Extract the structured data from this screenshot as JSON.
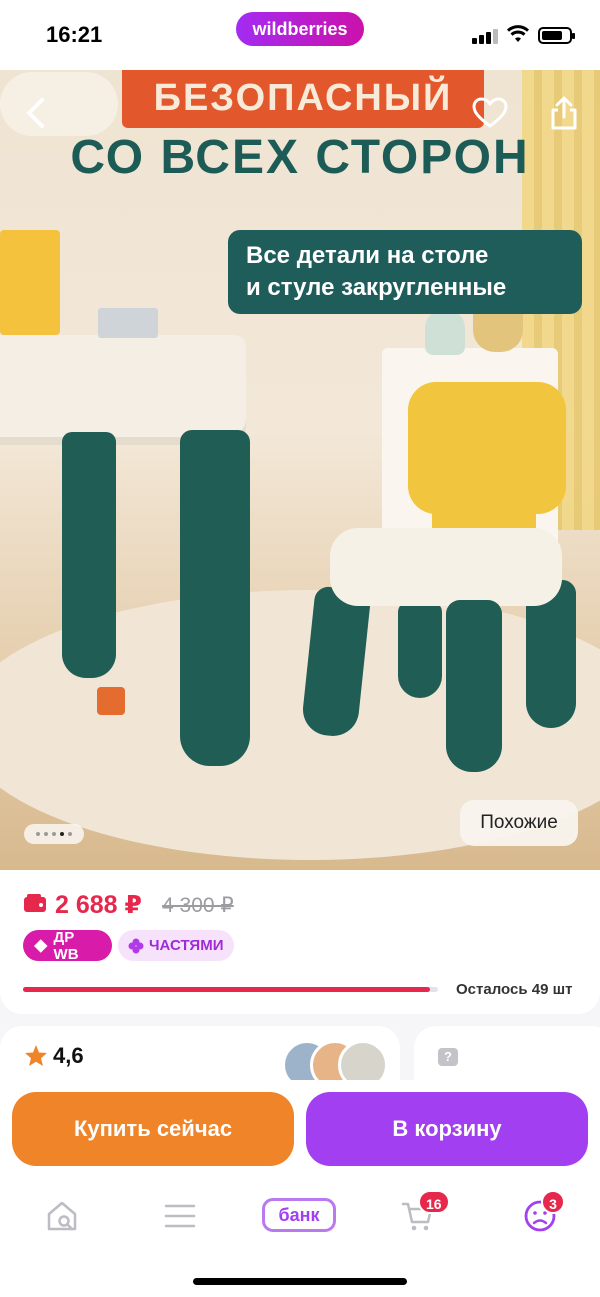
{
  "status_bar": {
    "time": "16:21",
    "brand": "wildberries"
  },
  "hero": {
    "promo_top": "БЕЗОПАСНЫЙ",
    "promo_title": "СО ВСЕХ СТОРОН",
    "promo_note_line1": "Все детали на столе",
    "promo_note_line2": "и стуле закругленные",
    "similar_label": "Похожие",
    "gallery_active_index": 3,
    "gallery_count": 4
  },
  "price": {
    "current": "2 688 ₽",
    "old": "4 300 ₽",
    "badge_dr": "ДР WB",
    "badge_parts": "ЧАСТЯМИ",
    "stock_label": "Осталось 49 шт",
    "stock_fraction": 0.98
  },
  "rating": {
    "value": "4,6"
  },
  "actions": {
    "buy_now": "Купить сейчас",
    "add_to_cart": "В корзину"
  },
  "tabbar": {
    "bank_label": "банк",
    "cart_count": "16",
    "profile_count": "3"
  },
  "colors": {
    "accent_purple": "#a23ff0",
    "accent_orange": "#f08428",
    "price_red": "#e5284c",
    "promo_teal": "#1f5d5b"
  },
  "icons": {
    "back": "chevron-left-icon",
    "favorite": "heart-icon",
    "share": "share-icon",
    "wallet": "wallet-icon",
    "star": "star-icon",
    "question": "question-icon",
    "home": "home-search-icon",
    "catalog": "menu-icon",
    "cart": "cart-icon",
    "profile": "profile-icon"
  }
}
